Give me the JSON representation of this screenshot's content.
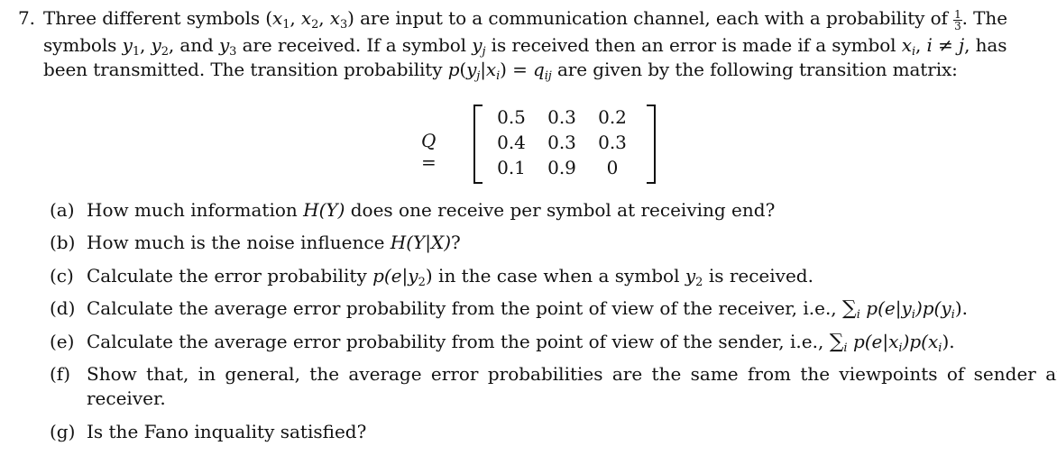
{
  "problem": {
    "number": "7.",
    "intro": {
      "l1_a": "Three different symbols (",
      "l1_x": "x",
      "l1_b": "are input to a communication channel, each with a probability of",
      "l1_frac_num": "1",
      "l1_frac_den": "3",
      "l1_c": ". The",
      "l2_a": "symbols",
      "l2_b": "and",
      "l2_c": "are received. If a symbol",
      "l2_d": "is received then an error is made if a symbol",
      "l2_e": "has",
      "l3_a": "been transmitted. The transition probability",
      "l3_b": "are given by the following transition matrix:"
    },
    "matrix": {
      "label": "Q =",
      "rows": [
        [
          "0.5",
          "0.3",
          "0.2"
        ],
        [
          "0.4",
          "0.3",
          "0.3"
        ],
        [
          "0.1",
          "0.9",
          "0"
        ]
      ]
    },
    "parts": [
      {
        "label": "(a)",
        "text_a": "How much information",
        "math": "H(Y)",
        "text_b": "does one receive per symbol at receiving end?"
      },
      {
        "label": "(b)",
        "text_a": "How much is the noise influence",
        "math": "H(Y|X)",
        "text_b": "?"
      },
      {
        "label": "(c)",
        "text_a": "Calculate the error probability",
        "math": "p(e|y",
        "math_sub": "2",
        "math_end": ")",
        "text_b": "in the case when a symbol",
        "text_c": "is received."
      },
      {
        "label": "(d)",
        "text_a": "Calculate the average error probability from the point of view of the receiver, i.e.,",
        "sum_sub": "i",
        "math": "p(e|y",
        "math_mid": ")p(y",
        "math_end": ")",
        "text_b": "."
      },
      {
        "label": "(e)",
        "text_a": "Calculate the average error probability from the point of view of the sender, i.e.,",
        "sum_sub": "i",
        "math": "p(e|x",
        "math_mid": ")p(x",
        "math_end": ")",
        "text_b": "."
      },
      {
        "label": "(f)",
        "text_a": "Show that, in general, the average error probabilities are the same from the viewpoints of sender and",
        "text_b": "receiver."
      },
      {
        "label": "(g)",
        "text_a": "Is the Fano inquality satisfied?"
      }
    ]
  }
}
